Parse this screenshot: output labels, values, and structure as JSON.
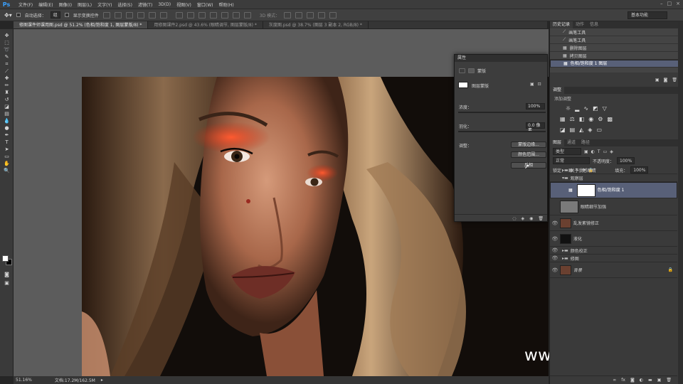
{
  "app": {
    "logo": "Ps"
  },
  "menu": [
    "文件(F)",
    "编辑(E)",
    "图像(I)",
    "图层(L)",
    "文字(Y)",
    "选择(S)",
    "滤镜(T)",
    "3D(D)",
    "视图(V)",
    "窗口(W)",
    "帮助(H)"
  ],
  "options": {
    "auto_select_label": "自动选择：",
    "auto_select_value": "组",
    "show_transform_label": "显示变换控件",
    "mode_label": "3D 模式："
  },
  "workspace": "基本功能",
  "tabs": [
    {
      "label": "修图课件师课用图.psd @ 51.2% (色相/饱和度 1, 图层蒙版/8) *"
    },
    {
      "label": "用修图课件2.psd @ 43.6% (眼睛调节, 图层蒙版/8) *"
    },
    {
      "label": "灰度图.psd @ 38.7% (图层 3 副本 2, RGB/8) *"
    }
  ],
  "status": {
    "zoom": "51.16%",
    "doc": "文档:17.2M/162.5M"
  },
  "properties": {
    "title": "属性",
    "mask_label": "蒙版",
    "layer_mask_label": "图层蒙版",
    "density_label": "浓度：",
    "density_value": "100%",
    "feather_label": "羽化：",
    "feather_value": "0.0 像素",
    "refine_label": "调整：",
    "btn_mask_edge": "蒙版边缘...",
    "btn_color_range": "颜色范围...",
    "btn_invert": "反相"
  },
  "panel_tabs": {
    "history": "历史记录",
    "actions": "动作",
    "info": "信息",
    "adjust": "调整",
    "layers": "图层",
    "channels": "通道",
    "paths": "路径",
    "adjust_title": "添加调整"
  },
  "history": [
    {
      "label": "画笔工具"
    },
    {
      "label": "画笔工具"
    },
    {
      "label": "删除图层"
    },
    {
      "label": "拷贝图层"
    },
    {
      "label": "色相/饱和度 1 图层"
    }
  ],
  "layers_controls": {
    "kind": "类型",
    "blend": "正常",
    "opacity_label": "不透明度：",
    "opacity": "100%",
    "lock_label": "锁定：",
    "fill_label": "填充：",
    "fill": "100%"
  },
  "layers": [
    {
      "name": "关于我感眼睛"
    },
    {
      "name": "观察层"
    },
    {
      "name": "色相/饱和度 1"
    },
    {
      "name": "眼睛细节加强"
    },
    {
      "name": "乱发紊镜修正"
    },
    {
      "name": "液化"
    },
    {
      "name": "颜色校正"
    },
    {
      "name": "修图"
    },
    {
      "name": "背景"
    }
  ],
  "watermark": "www.hunls.com",
  "colors": {
    "selection": "#586078",
    "accent": "#3aa0ff"
  }
}
